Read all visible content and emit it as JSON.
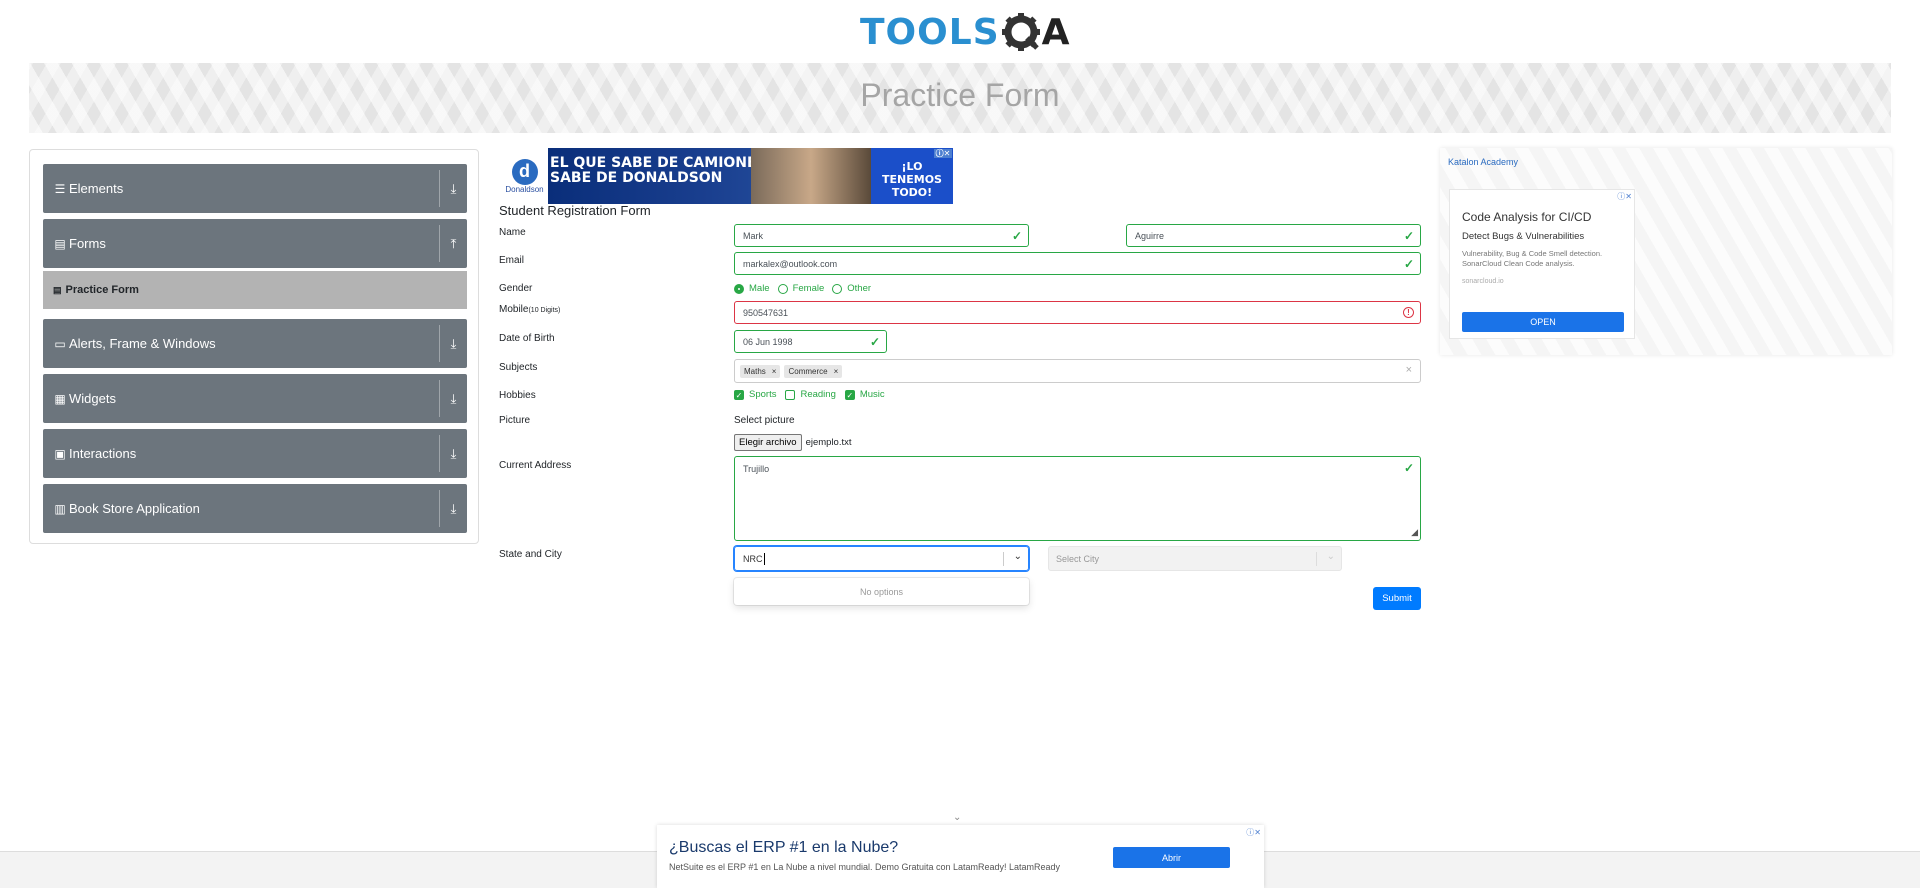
{
  "header": {
    "logo_left": "TOOLS",
    "logo_right": "A",
    "page_title": "Practice Form"
  },
  "sidebar": {
    "groups": [
      {
        "label": "Elements",
        "icon": "list-icon",
        "arrow": "⤓"
      },
      {
        "label": "Forms",
        "icon": "form-icon",
        "arrow": "⤒"
      },
      {
        "label": "Alerts, Frame & Windows",
        "icon": "window-icon",
        "arrow": "⤓"
      },
      {
        "label": "Widgets",
        "icon": "grid-icon",
        "arrow": "⤓"
      },
      {
        "label": "Interactions",
        "icon": "interactions-icon",
        "arrow": "⤓"
      },
      {
        "label": "Book Store Application",
        "icon": "books-icon",
        "arrow": "⤓"
      }
    ],
    "active_item": "Practice Form"
  },
  "top_ad": {
    "line1": "EL QUE SABE DE CAMIONES",
    "line2": "SABE DE DONALDSON",
    "right_line1": "¡LO",
    "right_line2": "TENEMOS",
    "right_line3": "TODO!",
    "brand": "Donaldson"
  },
  "form": {
    "title": "Student Registration Form",
    "labels": {
      "name": "Name",
      "email": "Email",
      "gender": "Gender",
      "mobile": "Mobile",
      "mobile_hint": "(10 Digits)",
      "dob": "Date of Birth",
      "subjects": "Subjects",
      "hobbies": "Hobbies",
      "picture": "Picture",
      "address": "Current Address",
      "state_city": "State and City"
    },
    "first_name": "Mark",
    "last_name": "Aguirre",
    "email": "markalex@outlook.com",
    "gender_options": [
      "Male",
      "Female",
      "Other"
    ],
    "gender_selected": "Male",
    "mobile": "950547631",
    "dob": "06 Jun 1998",
    "subjects": [
      "Maths",
      "Commerce"
    ],
    "hobbies": [
      {
        "label": "Sports",
        "checked": true
      },
      {
        "label": "Reading",
        "checked": false
      },
      {
        "label": "Music",
        "checked": true
      }
    ],
    "select_picture": "Select picture",
    "file_button": "Elegir archivo",
    "file_name": "ejemplo.txt",
    "address": "Trujillo",
    "state_input": "NRC",
    "state_menu": "No options",
    "city_placeholder": "Select City",
    "submit": "Submit"
  },
  "right_ad": {
    "broken_image_alt": "Katalon Academy",
    "title": "Code Analysis for CI/CD",
    "subtitle": "Detect Bugs & Vulnerabilities",
    "body": "Vulnerability, Bug & Code Smell detection. SonarCloud Clean Code analysis.",
    "domain": "sonarcloud.io",
    "button": "OPEN"
  },
  "bottom_ad": {
    "headline": "¿Buscas el ERP #1 en la Nube?",
    "sub": "NetSuite es el ERP #1 en La Nube a nivel mundial. Demo Gratuita con LatamReady! LatamReady",
    "button": "Abrir"
  },
  "colors": {
    "valid": "#28a745",
    "invalid": "#dc3545",
    "primary": "#007bff",
    "sidebar": "#6c757d"
  }
}
